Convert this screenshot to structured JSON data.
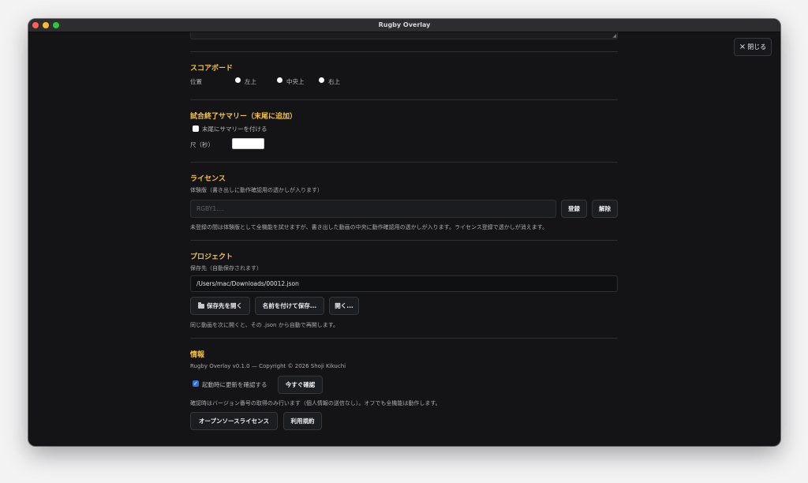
{
  "window": {
    "title": "Rugby Overlay"
  },
  "close_button": {
    "icon": "×",
    "label": "閉じる"
  },
  "scoreboard": {
    "heading": "スコアボード",
    "position_label": "位置",
    "options": [
      "左上",
      "中央上",
      "右上"
    ]
  },
  "summary": {
    "heading": "試合終了サマリー（末尾に追加）",
    "checkbox_label": "末尾にサマリーを付ける",
    "checked": false,
    "duration_label": "尺（秒）",
    "duration_value": ""
  },
  "license": {
    "heading": "ライセンス",
    "status": "体験版（書き出しに動作確認用の透かしが入ります）",
    "input_placeholder": "RGBY1....",
    "register_label": "登録",
    "release_label": "解除",
    "note": "未登録の間は体験版として全機能を試せますが、書き出した動画の中央に動作確認用の透かしが入ります。ライセンス登録で透かしが消えます。"
  },
  "project": {
    "heading": "プロジェクト",
    "save_location_label": "保存先（自動保存されます）",
    "save_path": "/Users/mac/Downloads/00012.json",
    "open_folder_label": "保存先を開く",
    "save_as_label": "名前を付けて保存...",
    "open_label": "開く...",
    "note": "同じ動画を次に開くと、その .json から自動で再開します。"
  },
  "info": {
    "heading": "情報",
    "version_text": "Rugby Overlay v0.1.0 — Copyright © 2026 Shoji Kikuchi",
    "update_checkbox_label": "起動時に更新を確認する",
    "update_checked": true,
    "check_now_label": "今すぐ確認",
    "note": "確認時はバージョン番号の取得のみ行います（個人情報の送信なし）。オフでも全機能は動作します。",
    "oss_license_label": "オープンソースライセンス",
    "terms_label": "利用規約"
  }
}
